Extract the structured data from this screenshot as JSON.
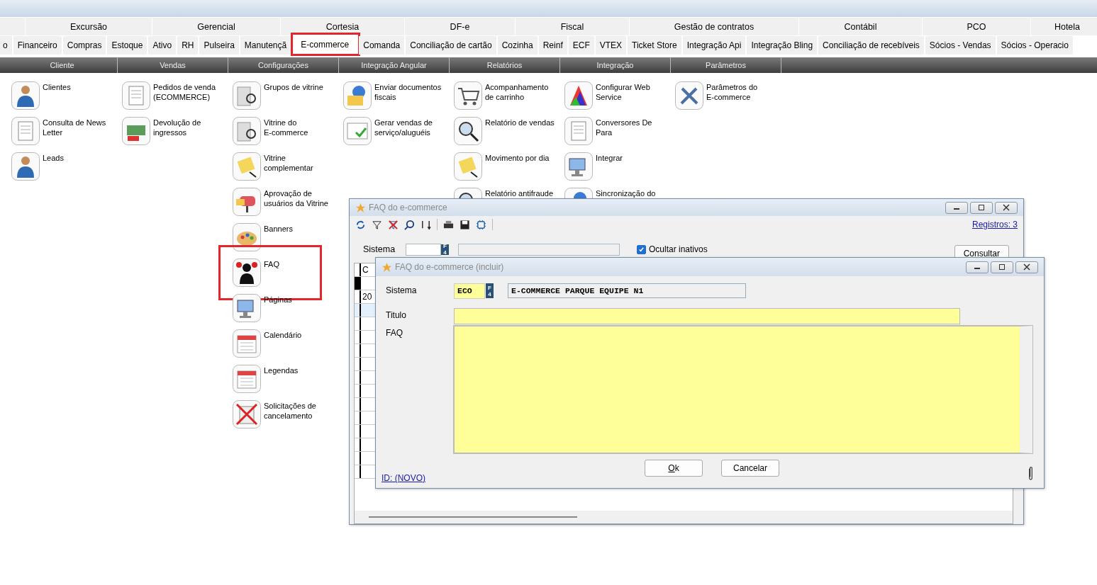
{
  "group_tabs": [
    {
      "label": "Excursão"
    },
    {
      "label": "Gerencial"
    },
    {
      "label": "Cortesia"
    },
    {
      "label": "DF-e"
    },
    {
      "label": "Fiscal"
    },
    {
      "label": "Gestão de contratos"
    },
    {
      "label": "Contábil"
    },
    {
      "label": "PCO"
    },
    {
      "label": "Hotela"
    }
  ],
  "module_tabs": [
    {
      "label": "o",
      "selected": false,
      "highlighted": false
    },
    {
      "label": "Financeiro",
      "selected": false,
      "highlighted": false
    },
    {
      "label": "Compras",
      "selected": false,
      "highlighted": false
    },
    {
      "label": "Estoque",
      "selected": false,
      "highlighted": false
    },
    {
      "label": "Ativo",
      "selected": false,
      "highlighted": false
    },
    {
      "label": "RH",
      "selected": false,
      "highlighted": false
    },
    {
      "label": "Pulseira",
      "selected": false,
      "highlighted": false
    },
    {
      "label": "Manutençã",
      "selected": false,
      "highlighted": false
    },
    {
      "label": "E-commerce",
      "selected": true,
      "highlighted": true
    },
    {
      "label": "Comanda",
      "selected": false,
      "highlighted": false
    },
    {
      "label": "Conciliação de cartão",
      "selected": false,
      "highlighted": false
    },
    {
      "label": "Cozinha",
      "selected": false,
      "highlighted": false
    },
    {
      "label": "Reinf",
      "selected": false,
      "highlighted": false
    },
    {
      "label": "ECF",
      "selected": false,
      "highlighted": false
    },
    {
      "label": "VTEX",
      "selected": false,
      "highlighted": false
    },
    {
      "label": "Ticket Store",
      "selected": false,
      "highlighted": false
    },
    {
      "label": "Integração Api",
      "selected": false,
      "highlighted": false
    },
    {
      "label": "Integração Bling",
      "selected": false,
      "highlighted": false
    },
    {
      "label": "Conciliação de recebíveis",
      "selected": false,
      "highlighted": false
    },
    {
      "label": "Sócios - Vendas",
      "selected": false,
      "highlighted": false
    },
    {
      "label": "Sócios - Operacio",
      "selected": false,
      "highlighted": false
    }
  ],
  "sections": [
    {
      "label": "Cliente",
      "items": [
        {
          "label": "Clientes",
          "highlighted": false
        },
        {
          "label": "Consulta de News\nLetter",
          "highlighted": false
        },
        {
          "label": "Leads",
          "highlighted": false
        }
      ]
    },
    {
      "label": "Vendas",
      "items": [
        {
          "label": "Pedidos de venda\n(ECOMMERCE)",
          "highlighted": false
        },
        {
          "label": "Devolução de\ningressos",
          "highlighted": false
        }
      ]
    },
    {
      "label": "Configurações",
      "items": [
        {
          "label": "Grupos de vitrine",
          "highlighted": false
        },
        {
          "label": "Vitrine do\nE-commerce",
          "highlighted": false
        },
        {
          "label": "Vitrine\ncomplementar",
          "highlighted": false
        },
        {
          "label": "Aprovação de\nusuários da Vitrine",
          "highlighted": false
        },
        {
          "label": "Banners",
          "highlighted": false
        },
        {
          "label": "FAQ",
          "highlighted": true
        },
        {
          "label": "Páginas",
          "highlighted": false
        },
        {
          "label": "Calendário",
          "highlighted": false
        },
        {
          "label": "Legendas",
          "highlighted": false
        },
        {
          "label": "Solicitações de\ncancelamento",
          "highlighted": false
        }
      ]
    },
    {
      "label": "Integração Angular",
      "items": [
        {
          "label": "Enviar documentos\nfiscais",
          "highlighted": false
        },
        {
          "label": "Gerar vendas de\nserviço/aluguéis",
          "highlighted": false
        }
      ]
    },
    {
      "label": "Relatórios",
      "items": [
        {
          "label": "Acompanhamento\nde carrinho",
          "highlighted": false
        },
        {
          "label": "Relatório de vendas",
          "highlighted": false
        },
        {
          "label": "Movimento por dia",
          "highlighted": false
        },
        {
          "label": "Relatório antifraude",
          "highlighted": false
        }
      ]
    },
    {
      "label": "Integração",
      "items": [
        {
          "label": "Configurar Web\nService",
          "highlighted": false
        },
        {
          "label": "Conversores De\nPara",
          "highlighted": false
        },
        {
          "label": "Integrar",
          "highlighted": false
        },
        {
          "label": "Sincronização do",
          "highlighted": false
        }
      ]
    },
    {
      "label": "Parâmetros",
      "items": [
        {
          "label": "Parâmetros do\nE-commerce",
          "highlighted": false
        }
      ]
    }
  ],
  "list_window": {
    "title": "FAQ do e-commerce",
    "records_link": "Registros: 3",
    "filter_label": "Sistema",
    "f4_label": "F4",
    "hide_inactive": {
      "label": "Ocultar inativos",
      "checked": true
    },
    "search_button": "Consultar",
    "grid": {
      "column_1": "C",
      "rows": [
        {
          "column_1": "20"
        }
      ]
    }
  },
  "form_window": {
    "title": "FAQ do e-commerce (incluir)",
    "system_label": "Sistema",
    "system_code": "ECO",
    "f4_label": "F4",
    "system_name": "E-COMMERCE PARQUE EQUIPE N1",
    "title_label": "Titulo",
    "faq_label": "FAQ",
    "ok_button": "Ok",
    "cancel_button": "Cancelar",
    "id_link": "ID: (NOVO)"
  }
}
